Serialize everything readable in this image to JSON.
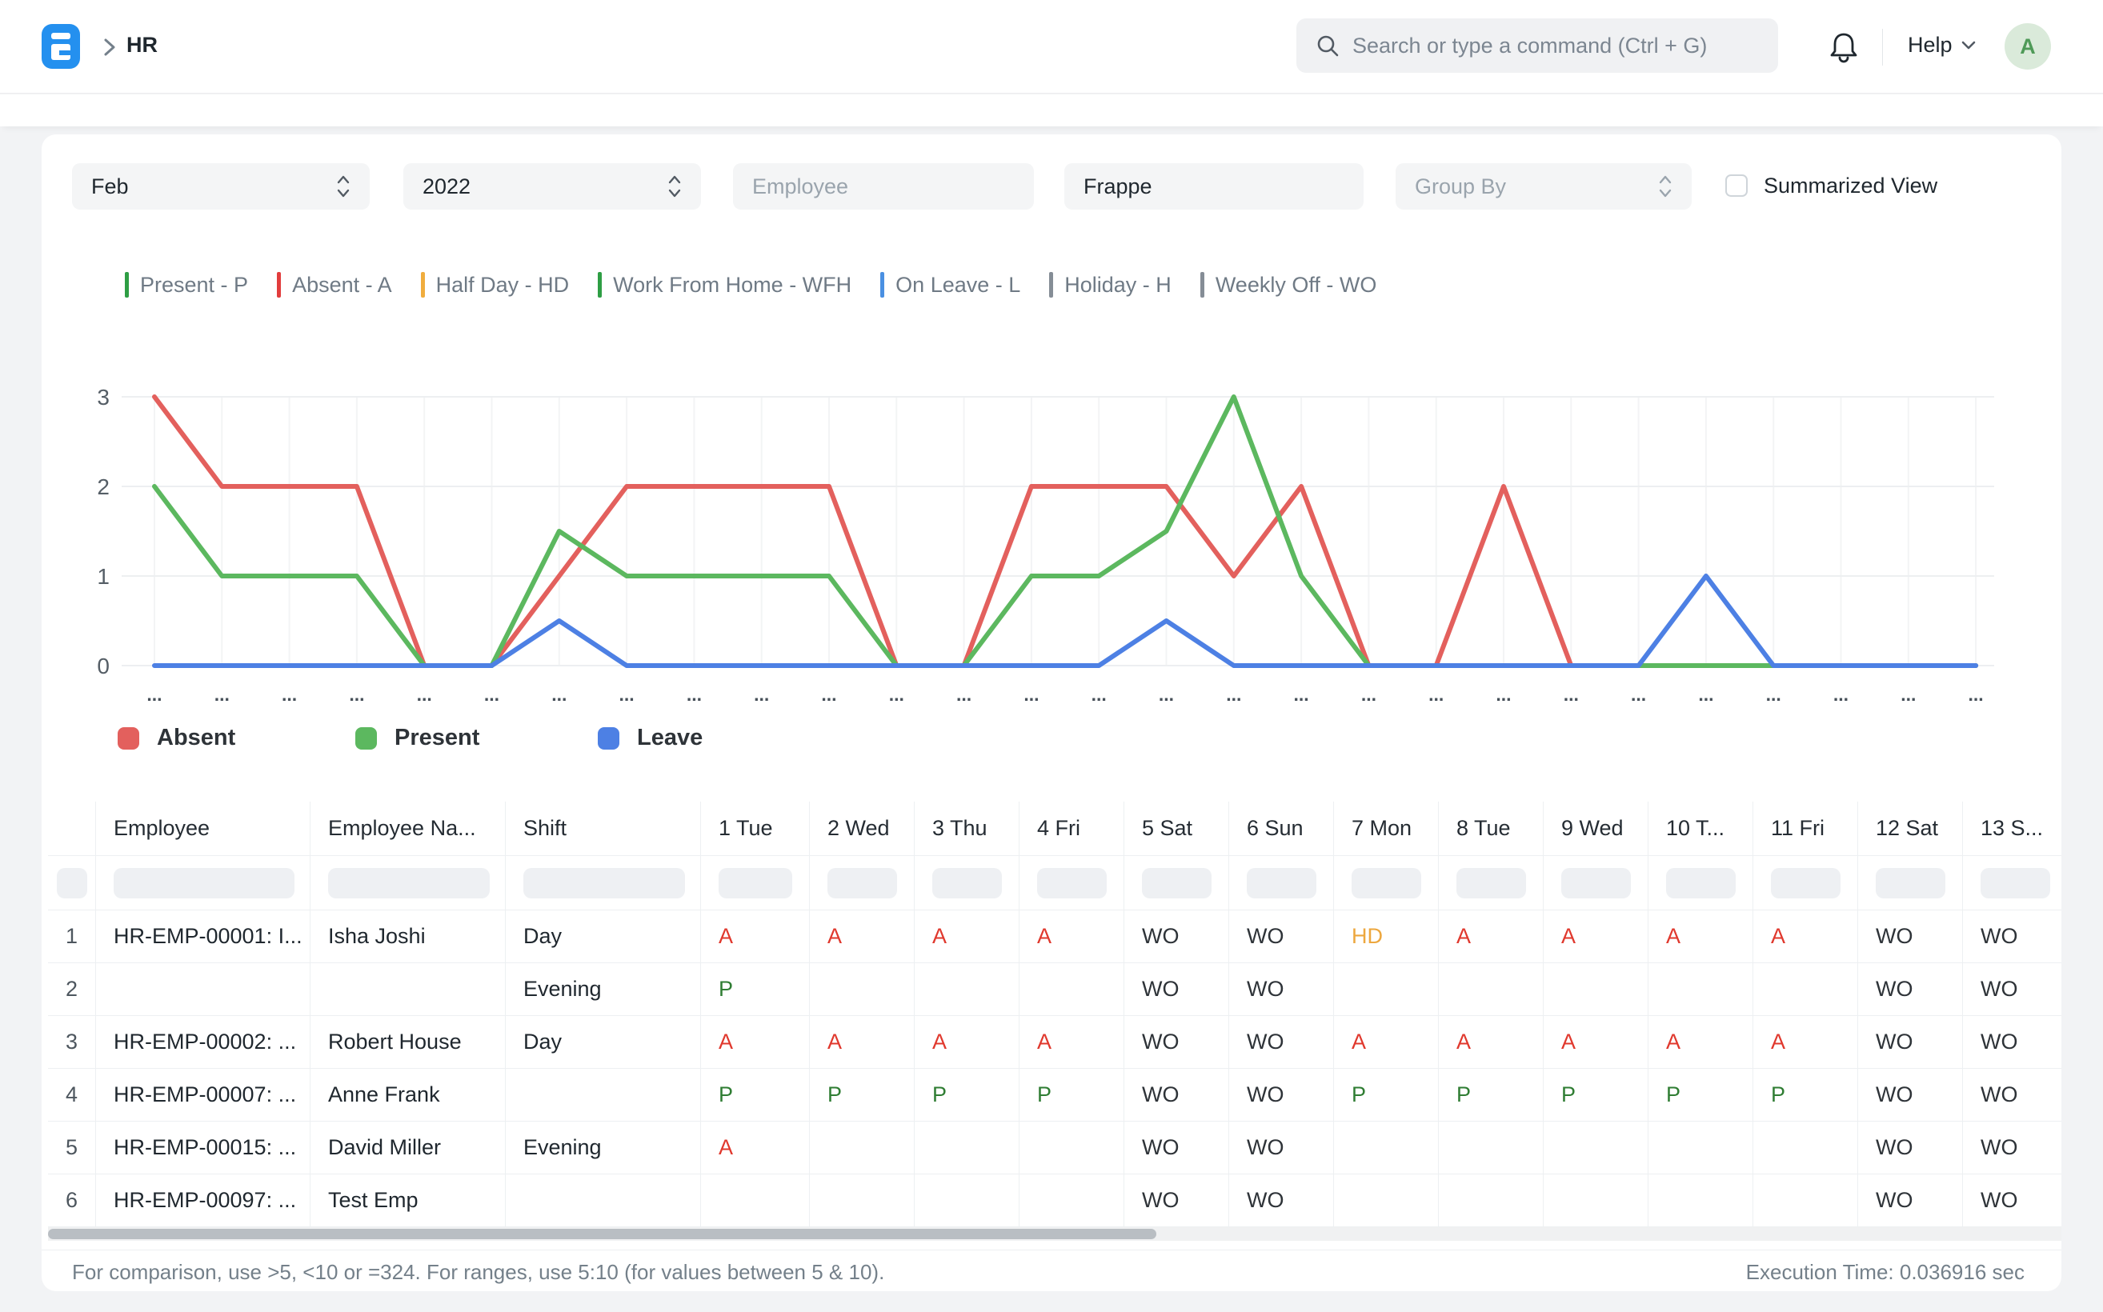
{
  "navbar": {
    "breadcrumb": "HR",
    "search_placeholder": "Search or type a command (Ctrl + G)",
    "help_label": "Help",
    "avatar_letter": "A",
    "logo_color": "#2490ef"
  },
  "filters": {
    "month": "Feb",
    "year": "2022",
    "employee_placeholder": "Employee",
    "company_value": "Frappe",
    "group_by_placeholder": "Group By",
    "summarized_view_label": "Summarized View",
    "summarized_view_checked": false
  },
  "status_legend": [
    {
      "label": "Present - P",
      "color": "#2e9e44"
    },
    {
      "label": "Absent - A",
      "color": "#e23d3d"
    },
    {
      "label": "Half Day - HD",
      "color": "#f0ad3e"
    },
    {
      "label": "Work From Home - WFH",
      "color": "#2e9e44"
    },
    {
      "label": "On Leave - L",
      "color": "#4a90e2"
    },
    {
      "label": "Holiday - H",
      "color": "#858d96"
    },
    {
      "label": "Weekly Off - WO",
      "color": "#858d96"
    }
  ],
  "chart_data": {
    "type": "line",
    "title": "",
    "xlabel": "",
    "ylabel": "",
    "ylim": [
      0,
      3
    ],
    "yticks": [
      0,
      1,
      2,
      3
    ],
    "grid": true,
    "num_points": 28,
    "x_tick_label": "...",
    "categories": [
      "...",
      "...",
      "...",
      "...",
      "...",
      "...",
      "...",
      "...",
      "...",
      "...",
      "...",
      "...",
      "...",
      "...",
      "...",
      "...",
      "...",
      "...",
      "...",
      "...",
      "...",
      "...",
      "...",
      "...",
      "...",
      "...",
      "...",
      "..."
    ],
    "legend_position": "bottom",
    "series": [
      {
        "name": "Absent",
        "color": "#e3605d",
        "values": [
          3,
          2,
          2,
          2,
          0,
          0,
          1,
          2,
          2,
          2,
          2,
          0,
          0,
          2,
          2,
          2,
          1,
          2,
          0,
          0,
          2,
          0,
          0,
          0,
          0,
          0,
          0,
          0
        ]
      },
      {
        "name": "Present",
        "color": "#5cb85f",
        "values": [
          2,
          1,
          1,
          1,
          0,
          0,
          1.5,
          1,
          1,
          1,
          1,
          0,
          0,
          1,
          1,
          1.5,
          3,
          1,
          0,
          0,
          0,
          0,
          0,
          0,
          0,
          0,
          0,
          0
        ]
      },
      {
        "name": "Leave",
        "color": "#4d80e4",
        "values": [
          0,
          0,
          0,
          0,
          0,
          0,
          0.5,
          0,
          0,
          0,
          0,
          0,
          0,
          0,
          0,
          0.5,
          0,
          0,
          0,
          0,
          0,
          0,
          0,
          1,
          0,
          0,
          0,
          0
        ]
      }
    ],
    "legend": [
      {
        "label": "Absent",
        "color": "#e3605d"
      },
      {
        "label": "Present",
        "color": "#5cb85f"
      },
      {
        "label": "Leave",
        "color": "#4d80e4"
      }
    ]
  },
  "table": {
    "columns": [
      "",
      "Employee",
      "Employee Na...",
      "Shift",
      "1 Tue",
      "2 Wed",
      "3 Thu",
      "4 Fri",
      "5 Sat",
      "6 Sun",
      "7 Mon",
      "8 Tue",
      "9 Wed",
      "10 T...",
      "11 Fri",
      "12 Sat",
      "13 S..."
    ],
    "status_colors": {
      "A": "#e0382d",
      "P": "#2f7d33",
      "HD": "#eda73e",
      "WO": "#2e3338"
    },
    "rows": [
      {
        "num": "1",
        "employee": "HR-EMP-00001: I...",
        "name": "Isha Joshi",
        "shift": "Day",
        "days": [
          "A",
          "A",
          "A",
          "A",
          "WO",
          "WO",
          "HD",
          "A",
          "A",
          "A",
          "A",
          "WO",
          "WO"
        ]
      },
      {
        "num": "2",
        "employee": "",
        "name": "",
        "shift": "Evening",
        "days": [
          "P",
          "",
          "",
          "",
          "WO",
          "WO",
          "",
          "",
          "",
          "",
          "",
          "WO",
          "WO"
        ]
      },
      {
        "num": "3",
        "employee": "HR-EMP-00002: ...",
        "name": "Robert House",
        "shift": "Day",
        "days": [
          "A",
          "A",
          "A",
          "A",
          "WO",
          "WO",
          "A",
          "A",
          "A",
          "A",
          "A",
          "WO",
          "WO"
        ]
      },
      {
        "num": "4",
        "employee": "HR-EMP-00007: ...",
        "name": "Anne Frank",
        "shift": "",
        "days": [
          "P",
          "P",
          "P",
          "P",
          "WO",
          "WO",
          "P",
          "P",
          "P",
          "P",
          "P",
          "WO",
          "WO"
        ]
      },
      {
        "num": "5",
        "employee": "HR-EMP-00015: ...",
        "name": "David Miller",
        "shift": "Evening",
        "days": [
          "A",
          "",
          "",
          "",
          "WO",
          "WO",
          "",
          "",
          "",
          "",
          "",
          "WO",
          "WO"
        ]
      },
      {
        "num": "6",
        "employee": "HR-EMP-00097: ...",
        "name": "Test Emp",
        "shift": "",
        "days": [
          "",
          "",
          "",
          "",
          "WO",
          "WO",
          "",
          "",
          "",
          "",
          "",
          "WO",
          "WO"
        ]
      }
    ]
  },
  "footer": {
    "hint": "For comparison, use >5, <10 or =324. For ranges, use 5:10 (for values between 5 & 10).",
    "execution_time": "Execution Time: 0.036916 sec"
  }
}
